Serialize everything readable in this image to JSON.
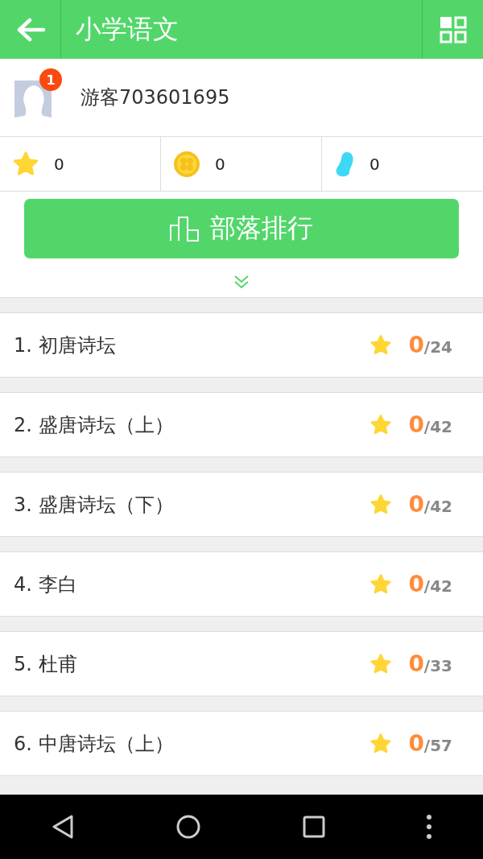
{
  "header": {
    "title": "小学语文"
  },
  "profile": {
    "name": "游客703601695",
    "badge": "1"
  },
  "stats": [
    {
      "kind": "star",
      "value": "0"
    },
    {
      "kind": "coin",
      "value": "0"
    },
    {
      "kind": "drop",
      "value": "0"
    }
  ],
  "rank_button": {
    "label": "部落排行"
  },
  "lessons": [
    {
      "title": "1. 初唐诗坛",
      "score": "0",
      "total": "/24"
    },
    {
      "title": "2. 盛唐诗坛（上）",
      "score": "0",
      "total": "/42"
    },
    {
      "title": "3. 盛唐诗坛（下）",
      "score": "0",
      "total": "/42"
    },
    {
      "title": "4. 李白",
      "score": "0",
      "total": "/42"
    },
    {
      "title": "5. 杜甫",
      "score": "0",
      "total": "/33"
    },
    {
      "title": "6. 中唐诗坛（上）",
      "score": "0",
      "total": "/57"
    }
  ]
}
